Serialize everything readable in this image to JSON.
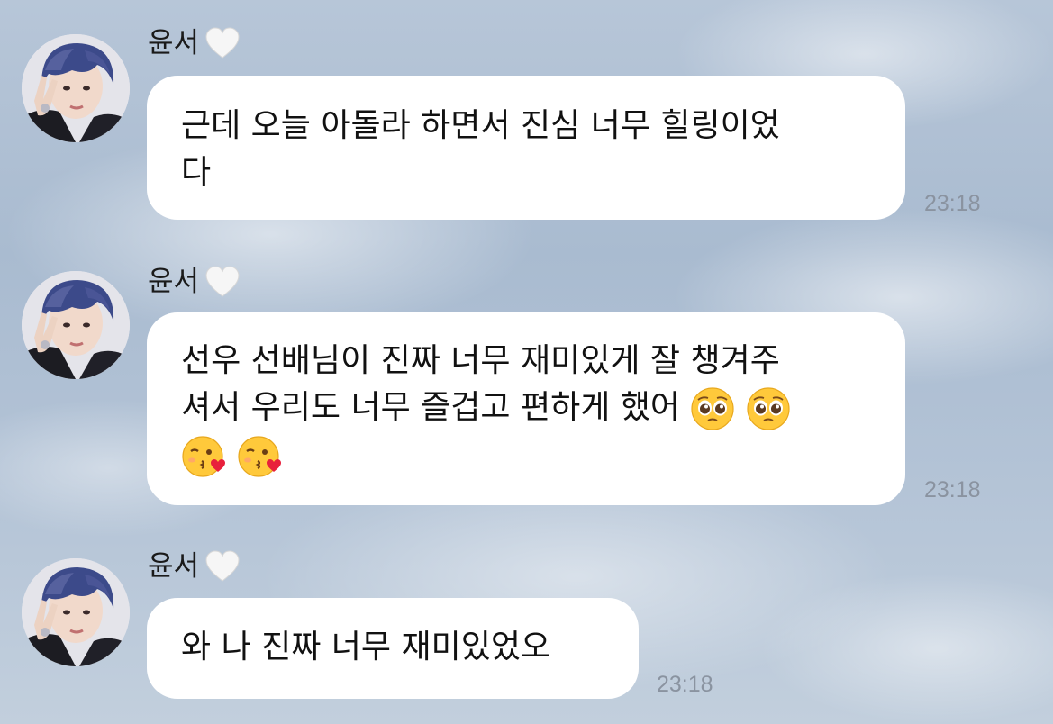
{
  "sender": {
    "name": "윤서",
    "name_icon": "white-heart-icon"
  },
  "messages": [
    {
      "text": "근데 오늘 아돌라 하면서 진심 너무 힐링이었\n다",
      "time": "23:18"
    },
    {
      "text_line1": "선우 선배님이 진짜 너무 재미있게 잘 챙겨주",
      "text_line2": "셔서 우리도 너무 즐겁고 편하게 했어",
      "emojis_inline": [
        "pleading-face-emoji",
        "pleading-face-emoji"
      ],
      "emojis_line3": [
        "kissing-heart-emoji",
        "kissing-heart-emoji"
      ],
      "time": "23:18"
    },
    {
      "text": "와 나 진짜 너무 재미있었오",
      "time": "23:18"
    }
  ],
  "colors": {
    "bubble": "#ffffff",
    "timestamp": "#8a93a0",
    "text": "#111111"
  }
}
